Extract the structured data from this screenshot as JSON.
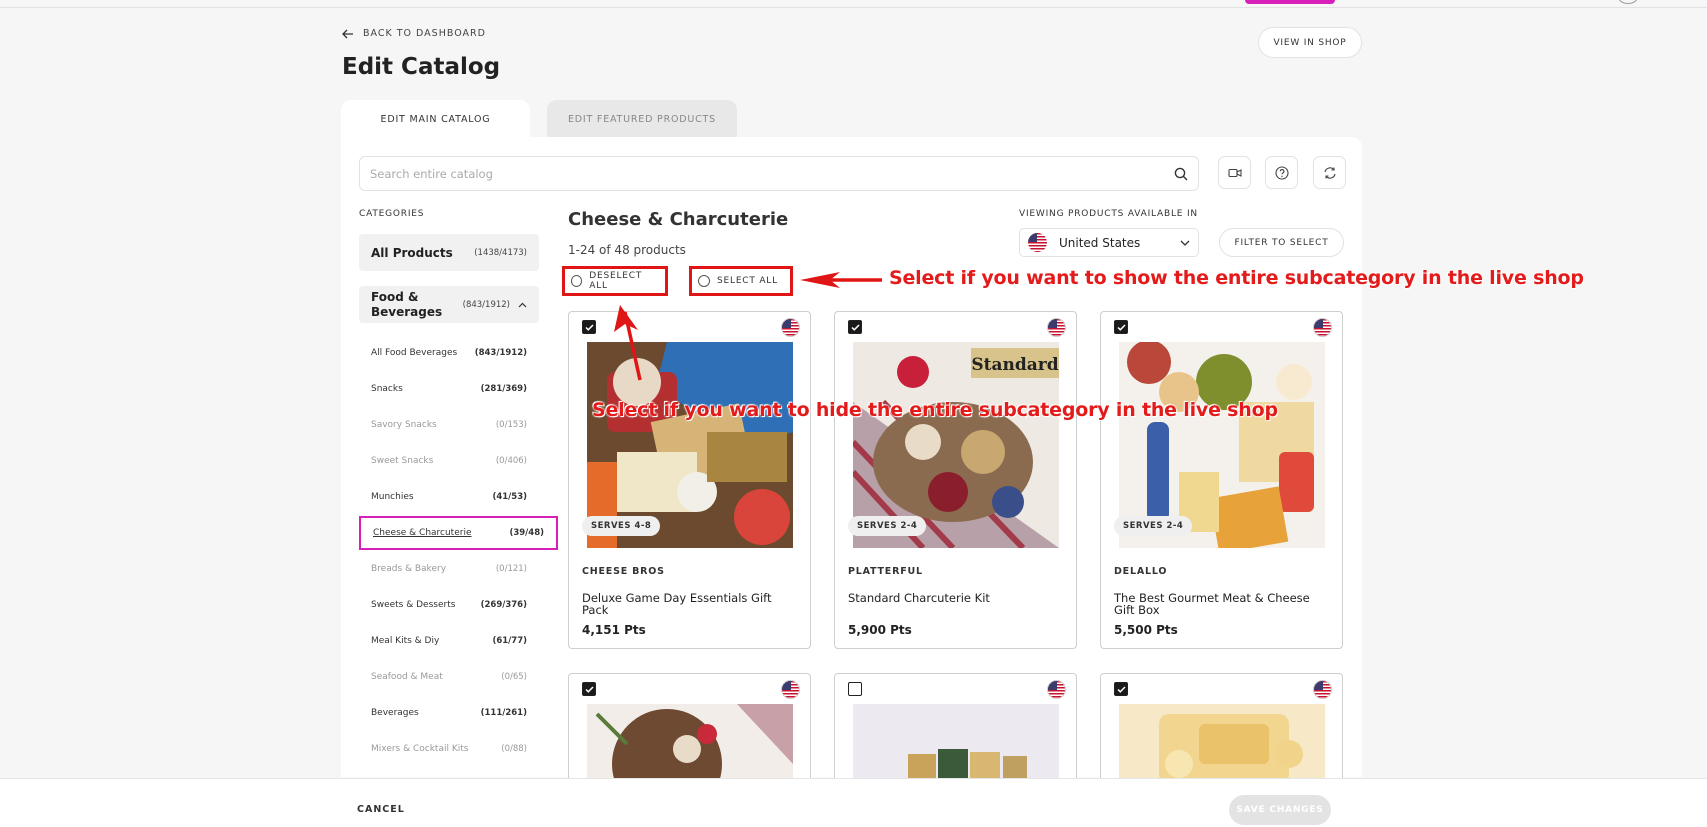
{
  "header": {
    "back_label": "BACK TO DASHBOARD",
    "title": "Edit Catalog",
    "view_in_shop": "VIEW IN SHOP"
  },
  "tabs": [
    {
      "label": "EDIT MAIN CATALOG",
      "active": true
    },
    {
      "label": "EDIT FEATURED PRODUCTS",
      "active": false
    }
  ],
  "search": {
    "placeholder": "Search entire catalog"
  },
  "categories": {
    "heading": "CATEGORIES",
    "all_products": {
      "label": "All Products",
      "count": "(1438/4173)"
    },
    "food_bev": {
      "label": "Food & Beverages",
      "count": "(843/1912)"
    },
    "subs": [
      {
        "label": "All Food Beverages",
        "count": "(843/1912)",
        "dim": false
      },
      {
        "label": "Snacks",
        "count": "(281/369)",
        "dim": false
      },
      {
        "label": "Savory Snacks",
        "count": "(0/153)",
        "dim": true
      },
      {
        "label": "Sweet Snacks",
        "count": "(0/406)",
        "dim": true
      },
      {
        "label": "Munchies",
        "count": "(41/53)",
        "dim": false
      },
      {
        "label": "Cheese & Charcuterie",
        "count": "(39/48)",
        "dim": false,
        "selected": true
      },
      {
        "label": "Breads & Bakery",
        "count": "(0/121)",
        "dim": true
      },
      {
        "label": "Sweets & Desserts",
        "count": "(269/376)",
        "dim": false
      },
      {
        "label": "Meal Kits & Diy",
        "count": "(61/77)",
        "dim": false
      },
      {
        "label": "Seafood & Meat",
        "count": "(0/65)",
        "dim": true
      },
      {
        "label": "Beverages",
        "count": "(111/261)",
        "dim": false
      },
      {
        "label": "Mixers & Cocktail Kits",
        "count": "(0/88)",
        "dim": true
      }
    ]
  },
  "main": {
    "title": "Cheese & Charcuterie",
    "count": "1-24 of 48 products",
    "viewing_label": "VIEWING PRODUCTS AVAILABLE IN",
    "country": "United States",
    "filter_label": "FILTER TO SELECT",
    "deselect_all": "DESELECT ALL",
    "select_all": "SELECT ALL"
  },
  "annotations": {
    "select_note": "Select if you want to show the entire subcategory in the live shop",
    "hide_note": "Select if you want to hide the entire subcategory in the live shop"
  },
  "products": [
    {
      "brand": "CHEESE BROS",
      "name": "Deluxe Game Day Essentials Gift Pack",
      "points": "4,151 Pts",
      "serves": "SERVES 4-8",
      "checked": true
    },
    {
      "brand": "PLATTERFUL",
      "name": "Standard Charcuterie Kit",
      "points": "5,900 Pts",
      "serves": "SERVES 2-4",
      "checked": true,
      "overlay_text": "Standard"
    },
    {
      "brand": "DELALLO",
      "name": "The Best Gourmet Meat & Cheese Gift Box",
      "points": "5,500 Pts",
      "serves": "SERVES 2-4",
      "checked": true
    },
    {
      "checked": true
    },
    {
      "checked": false
    },
    {
      "checked": true
    }
  ],
  "footer": {
    "cancel": "CANCEL",
    "save": "SAVE CHANGES"
  },
  "colors": {
    "accent_pink": "#d81fb9",
    "annotation_red": "#e01515",
    "save_disabled": "#e3e3e3"
  }
}
